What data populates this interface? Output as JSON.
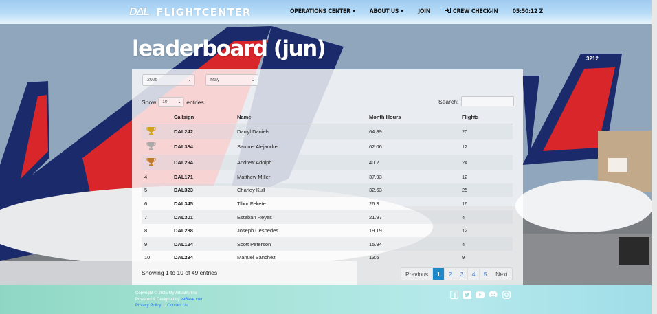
{
  "navbar": {
    "brand_logo_text": "DΔL",
    "brand_name": "FLIGHTCENTER",
    "links": {
      "operations": "OPERATIONS CENTER",
      "about": "ABOUT US",
      "join": "JOIN",
      "checkin": "CREW CHECK-IN"
    },
    "clock": "05:50:12 Z"
  },
  "page": {
    "title": "leaderboard (jun)"
  },
  "filters": {
    "year": "2025",
    "month": "May"
  },
  "table_controls": {
    "show_label": "Show",
    "entries_label": "entries",
    "length_value": "10",
    "search_label": "Search:"
  },
  "table": {
    "headers": [
      "",
      "Callsign",
      "Name",
      "Month Hours",
      "Flights"
    ],
    "rows": [
      {
        "rank": "",
        "trophy": "gold",
        "callsign": "DAL242",
        "name": "Darryl Daniels",
        "hours": "64.89",
        "flights": "20"
      },
      {
        "rank": "",
        "trophy": "silver",
        "callsign": "DAL384",
        "name": "Samuel Alejandre",
        "hours": "62.06",
        "flights": "12"
      },
      {
        "rank": "",
        "trophy": "bronze",
        "callsign": "DAL294",
        "name": "Andrew Adolph",
        "hours": "40.2",
        "flights": "24"
      },
      {
        "rank": "4",
        "callsign": "DAL171",
        "name": "Matthew Miller",
        "hours": "37.93",
        "flights": "12"
      },
      {
        "rank": "5",
        "callsign": "DAL323",
        "name": "Charley Kull",
        "hours": "32.63",
        "flights": "25"
      },
      {
        "rank": "6",
        "callsign": "DAL345",
        "name": "Tibor Fekete",
        "hours": "26.3",
        "flights": "16"
      },
      {
        "rank": "7",
        "callsign": "DAL301",
        "name": "Esteban Reyes",
        "hours": "21.97",
        "flights": "4"
      },
      {
        "rank": "8",
        "callsign": "DAL288",
        "name": "Joseph Cespedes",
        "hours": "19.19",
        "flights": "12"
      },
      {
        "rank": "9",
        "callsign": "DAL124",
        "name": "Scott Peterson",
        "hours": "15.94",
        "flights": "4"
      },
      {
        "rank": "10",
        "callsign": "DAL234",
        "name": "Manuel Sanchez",
        "hours": "13.6",
        "flights": "9"
      }
    ]
  },
  "info": "Showing 1 to 10 of 49 entries",
  "pagination": {
    "previous": "Previous",
    "pages": [
      "1",
      "2",
      "3",
      "4",
      "5"
    ],
    "active": "1",
    "next": "Next"
  },
  "footer": {
    "copyright": "Copyright © 2025 MyVirtualAirline",
    "designed_by_label": "Powered & Designed by",
    "designed_by_link": "vaBase.com",
    "privacy": "Privacy Policy",
    "separator": "|",
    "contact": "Contact Us"
  },
  "colors": {
    "active_page": "#1f88c8",
    "gold": "#d4a21c",
    "silver": "#a9a9a9",
    "bronze": "#c57a2a",
    "delta_red": "#d8262b",
    "delta_navy": "#1b2a6b"
  },
  "icons": [
    "facebook-icon",
    "twitter-icon",
    "youtube-icon",
    "discord-icon",
    "instagram-icon"
  ]
}
